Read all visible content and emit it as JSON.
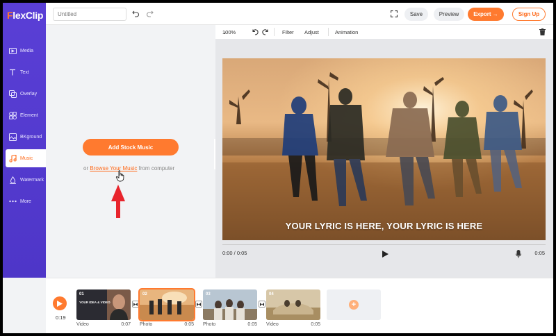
{
  "app": {
    "logo_f": "F",
    "logo_rest": "lexClip"
  },
  "topbar": {
    "title_placeholder": "Untitled",
    "save_label": "Save",
    "preview_label": "Preview",
    "export_label": "Export →",
    "signup_label": "Sign Up"
  },
  "sidebar": {
    "items": [
      {
        "label": "Media",
        "icon": "media-icon"
      },
      {
        "label": "Text",
        "icon": "text-icon"
      },
      {
        "label": "Overlay",
        "icon": "overlay-icon"
      },
      {
        "label": "Element",
        "icon": "element-icon"
      },
      {
        "label": "BKground",
        "icon": "background-icon"
      },
      {
        "label": "Music",
        "icon": "music-icon",
        "active": true
      },
      {
        "label": "Watermark",
        "icon": "watermark-icon"
      },
      {
        "label": "More",
        "icon": "more-icon"
      }
    ]
  },
  "music_panel": {
    "add_button": "Add Stock Music",
    "browse_prefix": "or ",
    "browse_link": "Browse Your Music",
    "browse_suffix": " from computer"
  },
  "editor_toolbar": {
    "zoom": "100%",
    "filter": "Filter",
    "adjust": "Adjust",
    "animation": "Animation"
  },
  "canvas": {
    "lyric_text": "YOUR LYRIC IS HERE,  YOUR LYRIC IS HERE"
  },
  "player": {
    "timecode": "0:00 / 0:05",
    "duration": "0:05"
  },
  "timeline": {
    "total_time": "0:19",
    "clips": [
      {
        "num": "01",
        "type": "Video",
        "duration": "0:07",
        "caption": "YOUR IDEA & VIDEO"
      },
      {
        "num": "02",
        "type": "Photo",
        "duration": "0:05",
        "selected": true
      },
      {
        "num": "03",
        "type": "Photo",
        "duration": "0:05"
      },
      {
        "num": "04",
        "type": "Video",
        "duration": "0:05"
      }
    ]
  },
  "colors": {
    "brand_purple": "#5a3fd6",
    "accent_orange": "#ff7a2f"
  }
}
